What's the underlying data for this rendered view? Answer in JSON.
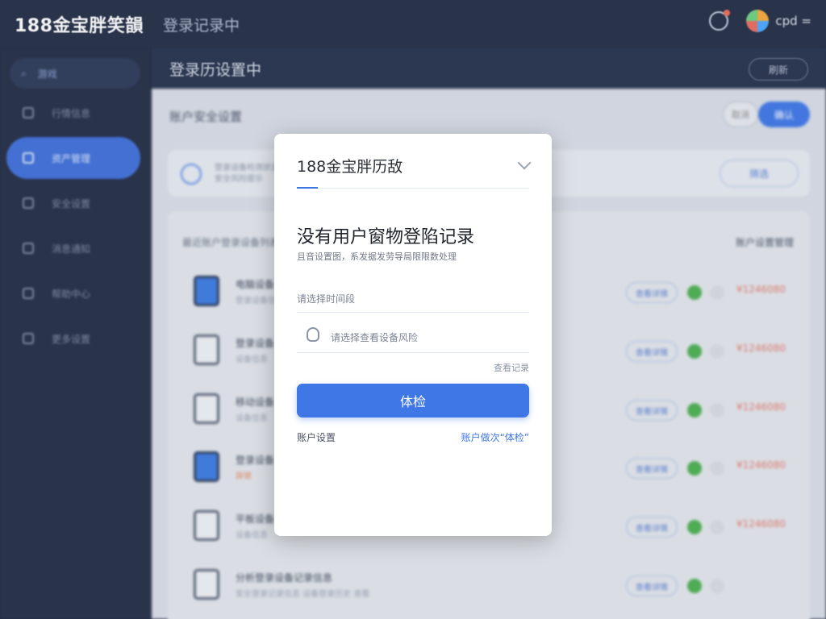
{
  "app": {
    "brand": "188金宝胖笑韻",
    "subtitle": "登录记录中",
    "user_name": "cpd ="
  },
  "sidebar": {
    "search_label": "游戏",
    "items": [
      {
        "label": "行情信息"
      },
      {
        "label": "资产管理",
        "active": true
      },
      {
        "label": "安全设置"
      },
      {
        "label": "消息通知"
      },
      {
        "label": "帮助中心"
      },
      {
        "label": "更多设置"
      }
    ]
  },
  "main": {
    "header_title": "登录历设置中",
    "header_button": "刷新",
    "section_title": "账户安全设置",
    "btn_ghost": "取消",
    "btn_primary": "确认",
    "filter_text_line1": "登录设备检测状态信息",
    "filter_text_line2": "安全风险提示",
    "filter_pill": "筛选",
    "list_header_left": "最近账户登录设备列表",
    "list_header_right": "账户设置管理",
    "rows": [
      {
        "title": "电脑设备",
        "sub": "登录设备信息",
        "pill": "查看详情",
        "amount": "¥1246080",
        "thumb": "blue"
      },
      {
        "title": "登录设备",
        "sub": "设备信息",
        "pill": "查看详情",
        "amount": "¥1246080",
        "thumb": "gray"
      },
      {
        "title": "移动设备",
        "sub": "设备信息",
        "pill": "查看详情",
        "amount": "¥1246080",
        "thumb": "gray"
      },
      {
        "title": "登录设备",
        "sub": "异常",
        "pill": "查看详情",
        "amount": "¥1246080",
        "thumb": "blue",
        "sub_warn": true
      },
      {
        "title": "平板设备",
        "sub": "设备信息",
        "pill": "查看详情",
        "amount": "¥1246080",
        "thumb": "gray"
      },
      {
        "title": "分析登录设备记录信息",
        "sub": "安全登录记录信息 设备登录历史 查看",
        "pill": "查看详情",
        "amount": "",
        "thumb": "gray"
      }
    ]
  },
  "modal": {
    "title": "188金宝胖历敌",
    "heading": "没有用户窗物登陷记录",
    "description": "且音设置图，系发据发劳导局限限数处理",
    "field1_placeholder": "请选择时间段",
    "field2_placeholder": "请选择查看设备风险",
    "forgot_link": "查看记录",
    "submit_label": "体检",
    "link_left": "账户设置",
    "link_right": "账户做次“体检”"
  },
  "colors": {
    "primary": "#3f77e6",
    "sidebar_bg": "#232d45",
    "success": "#4caf50",
    "warning_text": "#e37a6c"
  }
}
